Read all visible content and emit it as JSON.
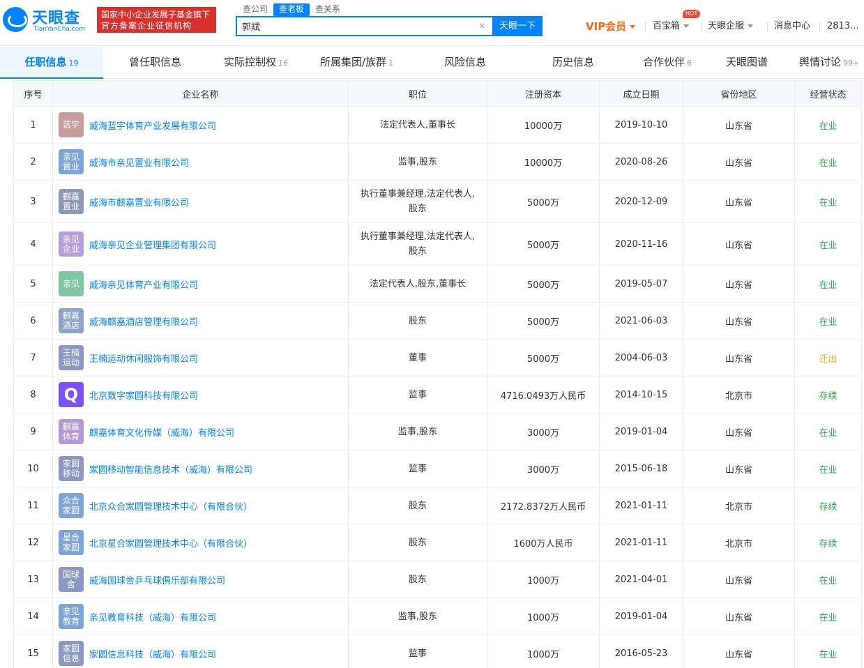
{
  "header": {
    "logo_name": "天眼查",
    "logo_sub": "TianYanCha.com",
    "slogan_line1": "国家中小企业发展子基金旗下",
    "slogan_line2": "官方备案企业征信机构",
    "search_tabs": [
      "查公司",
      "查老板",
      "查关系"
    ],
    "search_value": "郭斌",
    "search_clear": "×",
    "search_button": "天眼一下",
    "nav": {
      "vip": "VIP会员",
      "baobao": "百宝箱",
      "hot": "HOT",
      "qiyun": "天眼企服",
      "msg": "消息中心",
      "user": "2813..."
    }
  },
  "tabs": [
    {
      "label": "任职信息",
      "count": "19"
    },
    {
      "label": "曾任职信息",
      "count": ""
    },
    {
      "label": "实际控制权",
      "count": "16"
    },
    {
      "label": "所属集团/族群",
      "count": "1"
    },
    {
      "label": "风险信息",
      "count": ""
    },
    {
      "label": "历史信息",
      "count": ""
    },
    {
      "label": "合作伙伴",
      "count": "6"
    },
    {
      "label": "天眼图谱",
      "count": ""
    },
    {
      "label": "舆情讨论",
      "count": "99+"
    }
  ],
  "table": {
    "headers": [
      "序号",
      "企业名称",
      "职位",
      "注册资本",
      "成立日期",
      "省份地区",
      "经营状态"
    ],
    "rows": [
      {
        "no": "1",
        "logo": "蓝宇",
        "logo_color": "#c99c9c",
        "name": "威海蓝宇体育产业发展有限公司",
        "position": "法定代表人,董事长",
        "capital": "10000万",
        "date": "2019-10-10",
        "region": "山东省",
        "status": "在业",
        "status_color": "green",
        "tall": false
      },
      {
        "no": "2",
        "logo": "亲见置业",
        "logo_color": "#7fa5d8",
        "name": "威海市亲见置业有限公司",
        "position": "监事,股东",
        "capital": "10000万",
        "date": "2020-08-26",
        "region": "山东省",
        "status": "在业",
        "status_color": "green",
        "tall": false
      },
      {
        "no": "3",
        "logo": "麒嘉置业",
        "logo_color": "#8b98b6",
        "name": "威海市麒嘉置业有限公司",
        "position": "执行董事兼经理,法定代表人,股东",
        "capital": "5000万",
        "date": "2020-12-09",
        "region": "山东省",
        "status": "在业",
        "status_color": "green",
        "tall": true
      },
      {
        "no": "4",
        "logo": "亲见企业",
        "logo_color": "#b89fd9",
        "name": "威海亲见企业管理集团有限公司",
        "position": "执行董事兼经理,法定代表人,股东",
        "capital": "5000万",
        "date": "2020-11-16",
        "region": "山东省",
        "status": "在业",
        "status_color": "green",
        "tall": true
      },
      {
        "no": "5",
        "logo": "亲见",
        "logo_color": "#7ec7a1",
        "name": "威海亲见体育产业有限公司",
        "position": "法定代表人,股东,董事长",
        "capital": "5000万",
        "date": "2019-05-07",
        "region": "山东省",
        "status": "在业",
        "status_color": "green",
        "tall": false
      },
      {
        "no": "6",
        "logo": "麒嘉酒店",
        "logo_color": "#8da3c8",
        "name": "威海麒嘉酒店管理有限公司",
        "position": "股东",
        "capital": "5000万",
        "date": "2021-06-03",
        "region": "山东省",
        "status": "在业",
        "status_color": "green",
        "tall": false
      },
      {
        "no": "7",
        "logo": "王楠运动",
        "logo_color": "#8a99c1",
        "name": "王楠运动休闲服饰有限公司",
        "position": "董事",
        "capital": "5000万",
        "date": "2004-06-03",
        "region": "山东省",
        "status": "迁出",
        "status_color": "orange",
        "tall": false
      },
      {
        "no": "8",
        "logo": "Q",
        "logo_color": "#7b52f7",
        "name": "北京数字家圆科技有限公司",
        "position": "监事",
        "capital": "4716.0493万人民币",
        "date": "2014-10-15",
        "region": "北京市",
        "status": "存续",
        "status_color": "green",
        "tall": false
      },
      {
        "no": "9",
        "logo": "麒嘉体育",
        "logo_color": "#b39ad3",
        "name": "麒嘉体育文化传媒（威海）有限公司",
        "position": "监事,股东",
        "capital": "3000万",
        "date": "2019-01-04",
        "region": "山东省",
        "status": "在业",
        "status_color": "green",
        "tall": false
      },
      {
        "no": "10",
        "logo": "家圆移动",
        "logo_color": "#8a99c1",
        "name": "家圆移动智能信息技术（威海）有限公司",
        "position": "监事",
        "capital": "3000万",
        "date": "2015-06-18",
        "region": "山东省",
        "status": "在业",
        "status_color": "green",
        "tall": false
      },
      {
        "no": "11",
        "logo": "众合家圆",
        "logo_color": "#7fa5d8",
        "name": "北京众合家圆管理技术中心（有限合伙）",
        "position": "股东",
        "capital": "2172.8372万人民币",
        "date": "2021-01-11",
        "region": "北京市",
        "status": "存续",
        "status_color": "green",
        "tall": false
      },
      {
        "no": "12",
        "logo": "星合家圆",
        "logo_color": "#7fa5d8",
        "name": "北京星合家圆管理技术中心（有限合伙）",
        "position": "股东",
        "capital": "1600万人民币",
        "date": "2021-01-11",
        "region": "北京市",
        "status": "存续",
        "status_color": "green",
        "tall": false
      },
      {
        "no": "13",
        "logo": "国球舍",
        "logo_color": "#8a99c1",
        "name": "威海国球舍乒乓球俱乐部有限公司",
        "position": "股东",
        "capital": "1000万",
        "date": "2021-04-01",
        "region": "山东省",
        "status": "在业",
        "status_color": "green",
        "tall": false
      },
      {
        "no": "14",
        "logo": "亲见教育",
        "logo_color": "#7fa5d8",
        "name": "亲见教育科技（威海）有限公司",
        "position": "监事,股东",
        "capital": "1000万",
        "date": "2019-01-04",
        "region": "山东省",
        "status": "在业",
        "status_color": "green",
        "tall": false
      },
      {
        "no": "15",
        "logo": "家圆信息",
        "logo_color": "#8a99c1",
        "name": "家圆信息科技（威海）有限公司",
        "position": "监事",
        "capital": "1000万",
        "date": "2016-05-23",
        "region": "山东省",
        "status": "在业",
        "status_color": "green",
        "tall": false
      }
    ]
  }
}
